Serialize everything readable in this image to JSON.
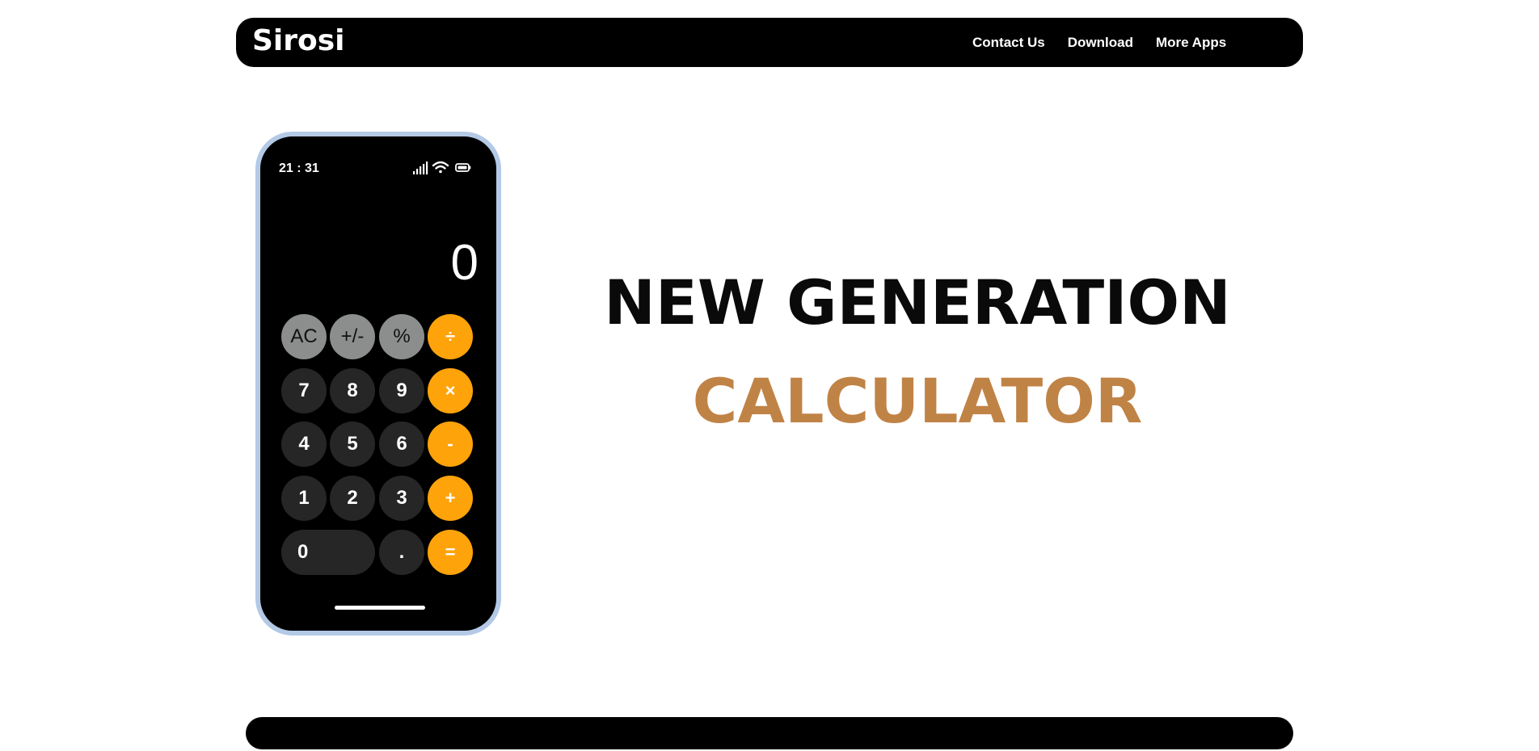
{
  "brand": {
    "name": "Sirosi"
  },
  "nav": {
    "links": [
      "Contact Us",
      "Download",
      "More Apps"
    ]
  },
  "phone": {
    "status_time": "21 : 31",
    "status_icons": [
      "signal-icon",
      "wifi-icon",
      "battery-icon"
    ],
    "display_value": "0",
    "keys": [
      {
        "label": "AC",
        "kind": "fn"
      },
      {
        "label": "+/-",
        "kind": "fn"
      },
      {
        "label": "%",
        "kind": "fn"
      },
      {
        "label": "÷",
        "kind": "op"
      },
      {
        "label": "7",
        "kind": "num"
      },
      {
        "label": "8",
        "kind": "num"
      },
      {
        "label": "9",
        "kind": "num"
      },
      {
        "label": "×",
        "kind": "op"
      },
      {
        "label": "4",
        "kind": "num"
      },
      {
        "label": "5",
        "kind": "num"
      },
      {
        "label": "6",
        "kind": "num"
      },
      {
        "label": "-",
        "kind": "op"
      },
      {
        "label": "1",
        "kind": "num"
      },
      {
        "label": "2",
        "kind": "num"
      },
      {
        "label": "3",
        "kind": "num"
      },
      {
        "label": "+",
        "kind": "op"
      },
      {
        "label": "0",
        "kind": "num"
      },
      {
        "label": ".",
        "kind": "num"
      },
      {
        "label": "=",
        "kind": "op"
      }
    ]
  },
  "hero": {
    "headline": "NEW GENERATION",
    "subheadline": "CALCULATOR"
  },
  "colors": {
    "accent_orange": "#ffa30a",
    "subheadline_brown": "#c08346",
    "phone_frame": "#b3c9e6",
    "function_key_gray": "#8b8e8c",
    "number_key_dark": "#262626"
  }
}
